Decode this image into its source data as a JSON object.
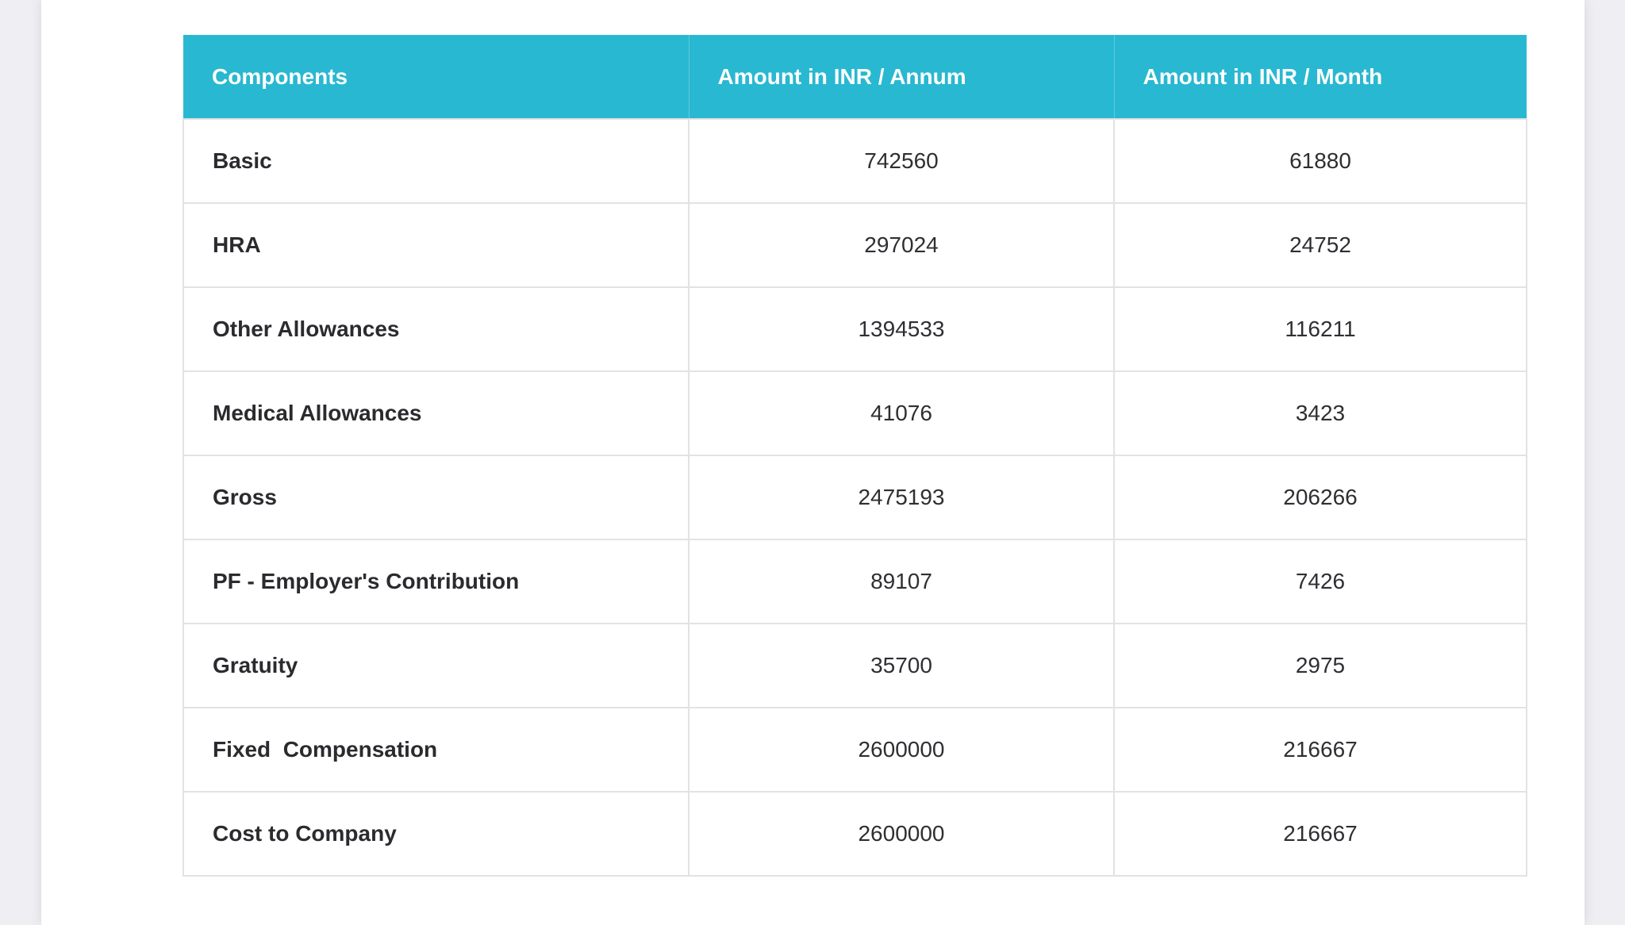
{
  "table": {
    "headers": [
      "Components",
      "Amount in INR / Annum",
      "Amount in INR / Month"
    ],
    "rows": [
      {
        "component": "Basic",
        "annum": "742560",
        "month": "61880"
      },
      {
        "component": "HRA",
        "annum": "297024",
        "month": "24752"
      },
      {
        "component": "Other Allowances",
        "annum": "1394533",
        "month": "116211"
      },
      {
        "component": "Medical Allowances",
        "annum": "41076",
        "month": "3423"
      },
      {
        "component": "Gross",
        "annum": "2475193",
        "month": "206266"
      },
      {
        "component": "PF - Employer's Contribution",
        "annum": "89107",
        "month": "7426"
      },
      {
        "component": "Gratuity",
        "annum": "35700",
        "month": "2975"
      },
      {
        "component": "Fixed  Compensation",
        "annum": "2600000",
        "month": "216667"
      },
      {
        "component": "Cost to Company",
        "annum": "2600000",
        "month": "216667"
      }
    ]
  },
  "colors": {
    "header_bg": "#29b8d1",
    "header_text": "#ffffff",
    "page_bg": "#eeeef3",
    "border": "#e2e2e6"
  }
}
